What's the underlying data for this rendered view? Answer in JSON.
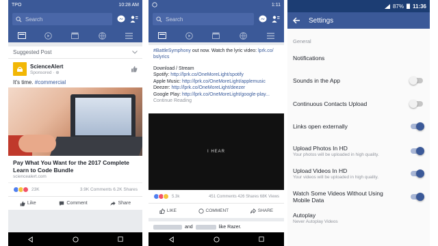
{
  "phone1": {
    "status_left": "TPO",
    "status_right": "10:28 AM",
    "search_placeholder": "Search",
    "suggested_label": "Suggested Post",
    "page_name": "ScienceAlert",
    "sponsored": "Sponsored · ⊕",
    "post_text_prefix": "It's time. ",
    "post_hashtag": "#commercial",
    "ad_title": "Pay What You Want for the 2017 Complete Learn to Code Bundle",
    "ad_url": "sciencealert.com",
    "reactions_count": "23K",
    "stats_right": "3.9K Comments 6.2K Shares",
    "like_label": "Like",
    "comment_label": "Comment",
    "share_label": "Share"
  },
  "phone2": {
    "status_right": "1:11",
    "search_placeholder": "Search",
    "line1_prefix": "",
    "line1_hashtag": "#BattleSymphony",
    "line1_suffix": " out now. Watch the lyric video: ",
    "line1_link": "lprk.co/",
    "line1_link2": "bslyrics",
    "download_label": "Download / Stream",
    "links": [
      {
        "label": "Spotify: ",
        "url": "http://lprk.co/OneMoreLight/spotify"
      },
      {
        "label": "Apple Music: ",
        "url": "http://lprk.co/OneMoreLight/applemusic"
      },
      {
        "label": "Deezer: ",
        "url": "http://lprk.co/OneMoreLight/deezer"
      },
      {
        "label": "Google Play: ",
        "url": "http://lprk.co/OneMoreLight/google-play..."
      }
    ],
    "continue_reading": "Continue Reading",
    "video_text": "I HEAR",
    "reactions_count": "5.3k",
    "stats_right": "451 Comments 426 Shares 68K Views",
    "like_label": "LIKE",
    "comment_label": "COMMENT",
    "share_label": "SHARE",
    "next_text_mid": "and",
    "next_text_end": "like Razer."
  },
  "phone3": {
    "status_battery": "87%",
    "status_time": "11:36",
    "title": "Settings",
    "section_general": "General",
    "rows": [
      {
        "label": "Notifications",
        "sub": "",
        "toggle": null
      },
      {
        "label": "Sounds in the App",
        "sub": "",
        "toggle": "off"
      },
      {
        "label": "Continuous Contacts Upload",
        "sub": "",
        "toggle": "off"
      },
      {
        "label": "Links open externally",
        "sub": "",
        "toggle": "on"
      },
      {
        "label": "Upload Photos In HD",
        "sub": "Your photos will be uploaded in high quality.",
        "toggle": "on"
      },
      {
        "label": "Upload Videos In HD",
        "sub": "Your videos will be uploaded in high quality.",
        "toggle": "on"
      },
      {
        "label": "Watch Some Videos Without Using Mobile Data",
        "sub": "",
        "toggle": "on"
      },
      {
        "label": "Autoplay",
        "sub": "Never Autoplay Videos",
        "toggle": null
      }
    ]
  },
  "colors": {
    "fb_blue": "#3b5998",
    "link": "#365899",
    "toggle_on": "#3b5998"
  }
}
